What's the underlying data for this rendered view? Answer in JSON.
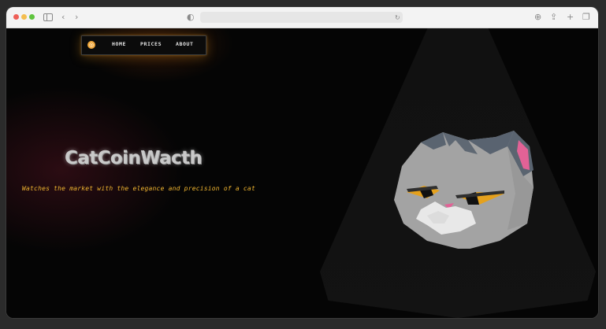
{
  "nav": {
    "logo_glyph": "◎",
    "links": [
      "HOME",
      "PRICES",
      "ABOUT"
    ]
  },
  "hero": {
    "title": "CatCoinWacth",
    "tagline": "Watches the market with the elegance and precision of a cat"
  },
  "colors": {
    "accent": "#f0b530",
    "logo": "#f0a73a",
    "cat_fur": "#a3a3a3",
    "cat_ear": "#5a6470",
    "cat_ear_inner": "#e26296",
    "cat_eye": "#e5a11d"
  }
}
